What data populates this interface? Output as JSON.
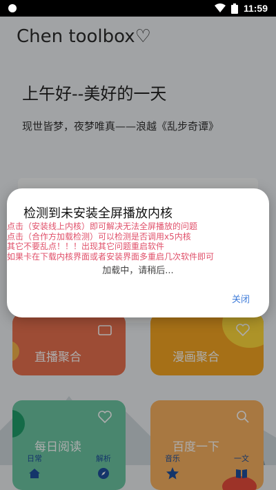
{
  "status_bar": {
    "time": "11:59",
    "icons": [
      "circle-icon",
      "wifi-icon",
      "battery-icon"
    ]
  },
  "app": {
    "title": "Chen toolbox♡",
    "greeting": "上午好--美好的一天",
    "quote": "现世皆梦，夜梦唯真——浪越《乱步奇谭》"
  },
  "tiles": {
    "live": "直播聚合",
    "comic": "漫画聚合",
    "read": "每日阅读",
    "baidu": "百度一下"
  },
  "nav": {
    "items": [
      {
        "label": "日常",
        "icon": "home-icon"
      },
      {
        "label": "解析",
        "icon": "compass-icon"
      },
      {
        "label": "音乐",
        "icon": "star-icon"
      },
      {
        "label": "一文",
        "icon": "book-icon"
      }
    ]
  },
  "dialog": {
    "title": "检测到未安装全屏播放内核",
    "messages": [
      "点击（安装线上内核）即可解决无法全屏播放的问题",
      "点击（合作方加载检测）可以检测是否调用x5内核",
      "其它不要乱点！！！出现其它问题重启软件",
      "如果卡在下载内核界面或者安装界面多重启几次软件即可"
    ],
    "loading": "加载中，请稍后...",
    "close_label": "关闭"
  },
  "colors": {
    "accent": "#3d7bd9",
    "warning_text": "#e0506a",
    "tile_live": "#e8704e",
    "tile_comic": "#f5a623",
    "tile_read": "#6cc6a2",
    "tile_baidu": "#f8b160"
  }
}
